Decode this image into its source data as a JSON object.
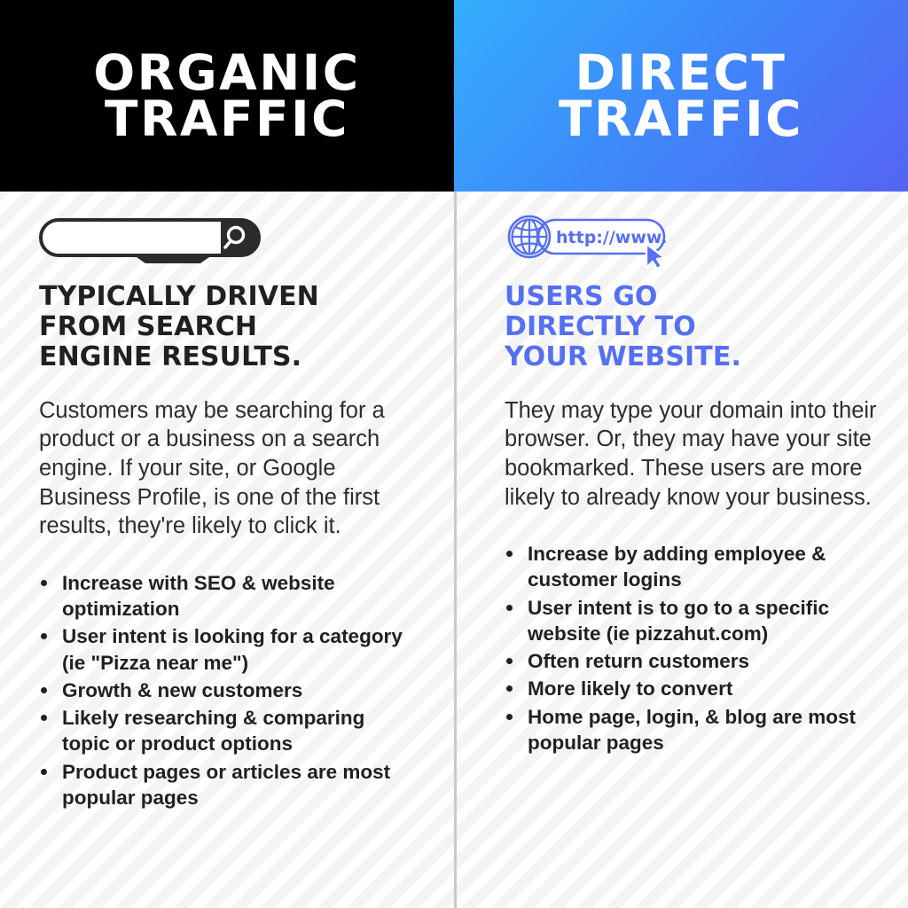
{
  "columns": [
    {
      "header": {
        "title": "Organic\nTraffic",
        "background_color": "#000000",
        "text_color": "#ffffff"
      },
      "icon": "search-bar-icon",
      "sub_heading": "Typically driven\nfrom search\nengine results.",
      "sub_heading_color": "#221f1f",
      "body": "Customers may be searching for a product or a business on a search engine. If your site, or Google Business Profile, is one of the first results, they're likely to click it.",
      "bullets": [
        "Increase with SEO & website optimization",
        "User intent is looking for a category (ie \"Pizza near me\")",
        "Growth & new customers",
        "Likely researching & comparing topic or product options",
        "Product pages or articles are most popular pages"
      ]
    },
    {
      "header": {
        "title": "Direct\nTraffic",
        "background_gradient_from": "#34aefc",
        "background_gradient_to": "#5564f4",
        "text_color": "#ffffff"
      },
      "icon": "globe-url-bar-icon",
      "icon_label": "http://www.",
      "sub_heading": "Users go\ndirectly to\nyour website.",
      "sub_heading_color": "#5570f0",
      "body": "They may type your domain into their browser. Or, they may have your site bookmarked. These users are more likely to already know your business.",
      "bullets": [
        "Increase by adding employee & customer logins",
        "User intent is to go to a specific website (ie pizzahut.com)",
        "Often return customers",
        "More likely to convert",
        "Home page, login, & blog are most popular pages"
      ]
    }
  ],
  "theme": {
    "accent_blue": "#5570f0",
    "background": "#ffffff",
    "stripe_color": "#f4f4f5",
    "divider_color": "#c9c9cd"
  }
}
